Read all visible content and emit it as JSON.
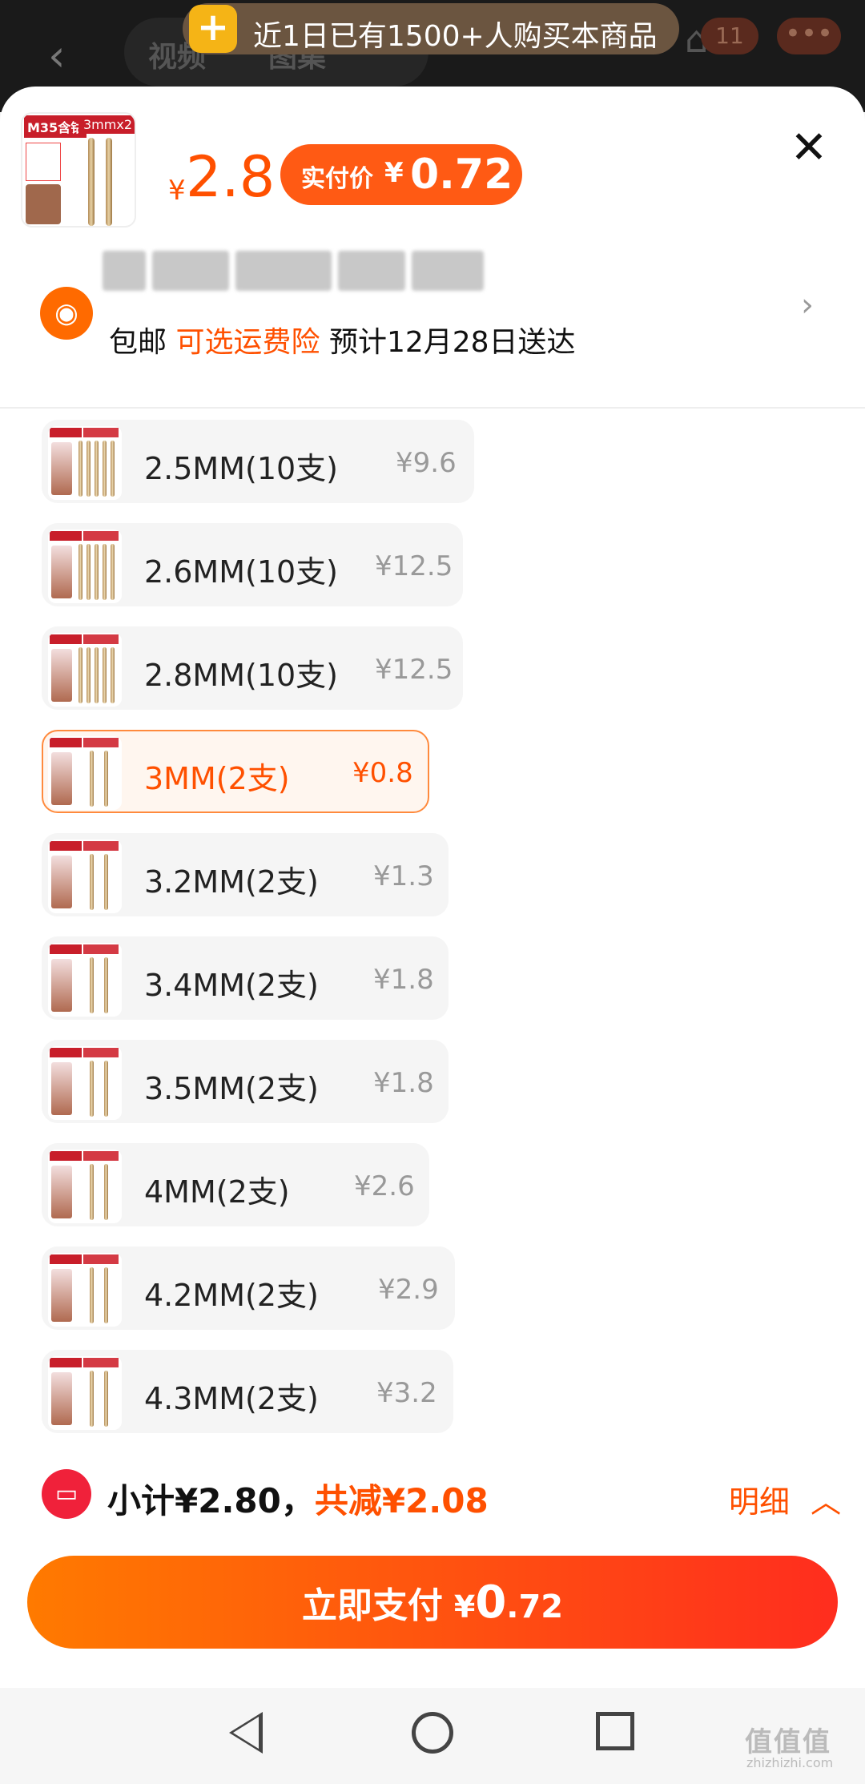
{
  "notification": {
    "text": "近1日已有1500+人购买本商品"
  },
  "background_header": {
    "tabs": [
      "视频",
      "图集"
    ],
    "cart_count": "11"
  },
  "product": {
    "thumb_tag_left": "M35含钴",
    "thumb_tag_right": "3mmx2",
    "price_symbol": "¥",
    "price": "2.8",
    "real_price_label": "实付价",
    "real_price_symbol": "¥",
    "real_price": "0.72"
  },
  "shipping": {
    "free": "包邮",
    "insurance": "可选运费险",
    "eta": "预计12月28日送达"
  },
  "skus": [
    {
      "label": "2.5MM(10支)",
      "price": "¥9.6",
      "selected": false
    },
    {
      "label": "2.6MM(10支)",
      "price": "¥12.5",
      "selected": false
    },
    {
      "label": "2.8MM(10支)",
      "price": "¥12.5",
      "selected": false
    },
    {
      "label": "3MM(2支)",
      "price": "¥0.8",
      "selected": true
    },
    {
      "label": "3.2MM(2支)",
      "price": "¥1.3",
      "selected": false
    },
    {
      "label": "3.4MM(2支)",
      "price": "¥1.8",
      "selected": false
    },
    {
      "label": "3.5MM(2支)",
      "price": "¥1.8",
      "selected": false
    },
    {
      "label": "4MM(2支)",
      "price": "¥2.6",
      "selected": false
    },
    {
      "label": "4.2MM(2支)",
      "price": "¥2.9",
      "selected": false
    },
    {
      "label": "4.3MM(2支)",
      "price": "¥3.2",
      "selected": false
    }
  ],
  "summary": {
    "subtotal": "小计¥2.80，",
    "discount": "共减¥2.08",
    "detail": "明细"
  },
  "pay_button": {
    "label": "立即支付",
    "symbol": "¥",
    "amount_int": "0",
    "amount_dec": ".72"
  },
  "watermark": {
    "text": "值值值",
    "sub": "zhizhizhi.com"
  },
  "colors": {
    "accent": "#ff5000",
    "selected_border": "#ff8a3d",
    "pay_gradient_start": "#ff7a00",
    "pay_gradient_end": "#ff2d1e"
  }
}
